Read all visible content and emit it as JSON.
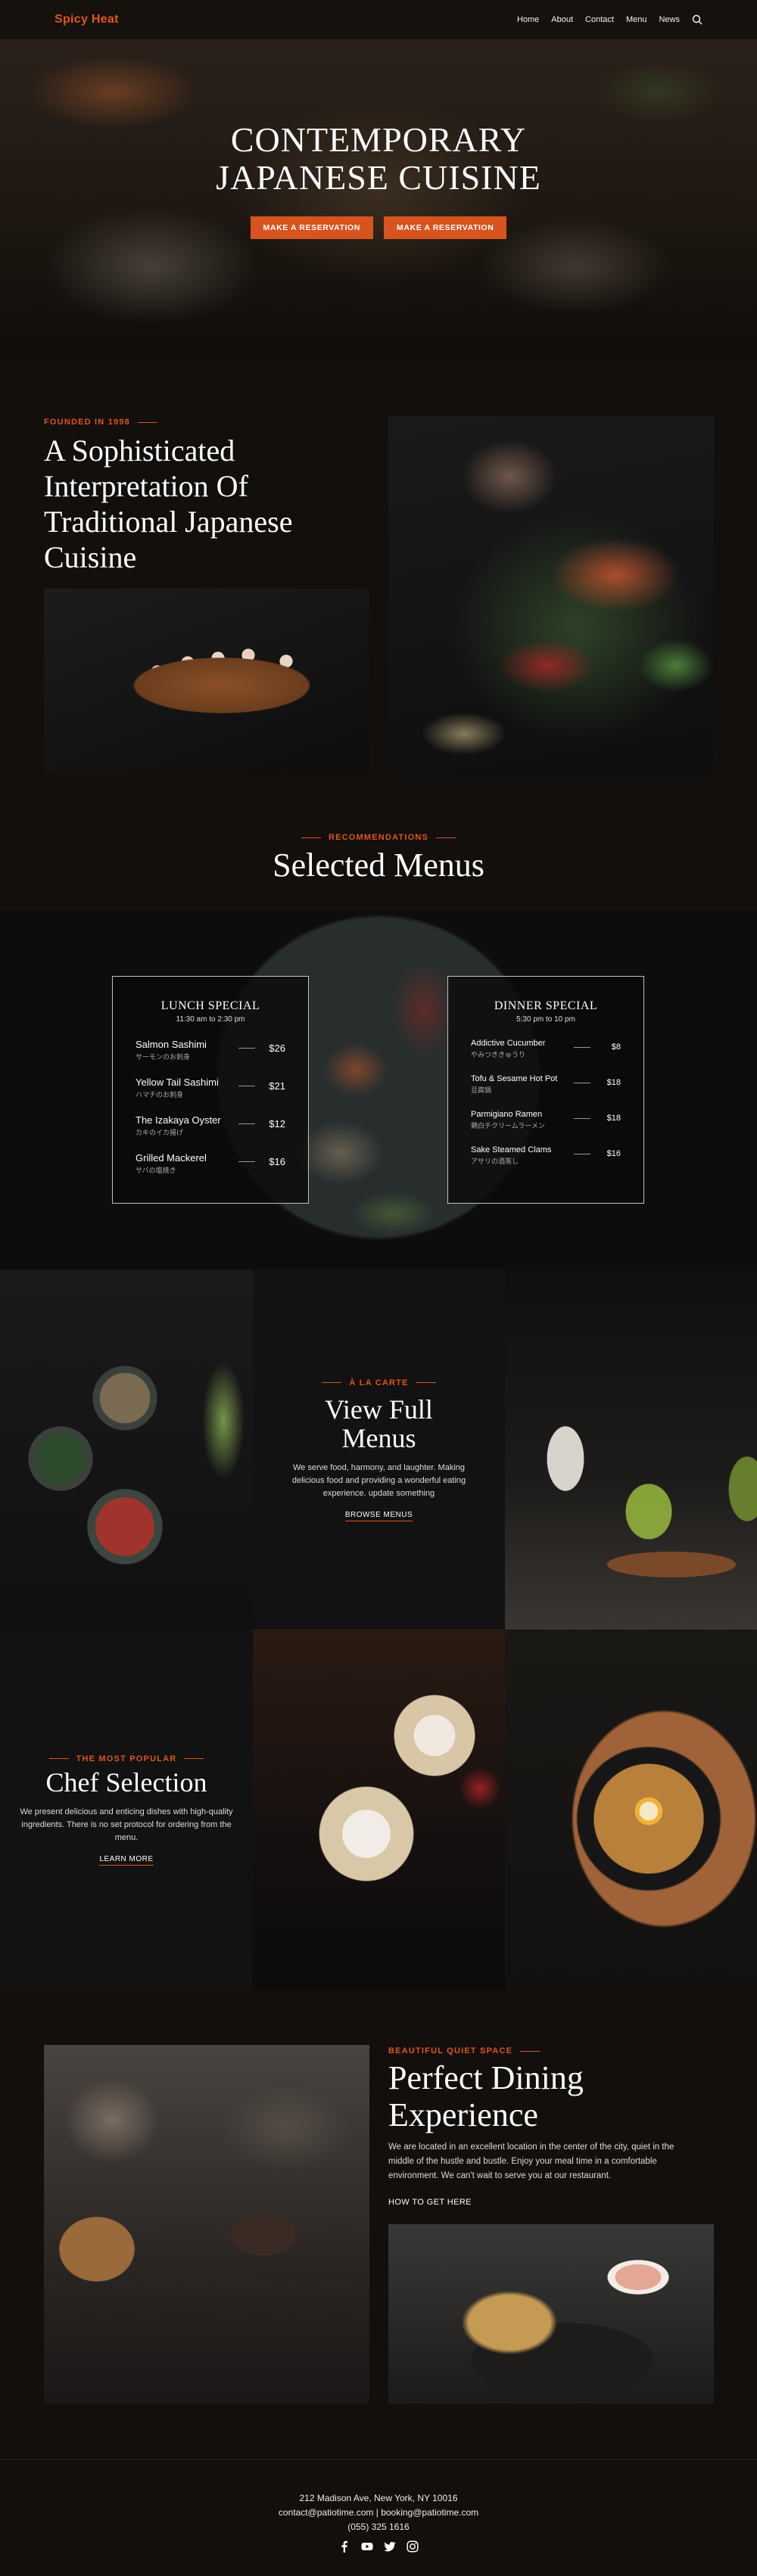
{
  "header": {
    "logo": "Spicy Heat",
    "nav": [
      "Home",
      "About",
      "Contact",
      "Menu",
      "News"
    ]
  },
  "hero": {
    "title_line1": "CONTEMPORARY",
    "title_line2": "JAPANESE CUISINE",
    "button1": "MAKE A RESERVATION",
    "button2": "MAKE A RESERVATION"
  },
  "about": {
    "eyebrow": "FOUNDED IN 1998",
    "title": "A Sophisticated Interpretation Of Traditional Japanese Cuisine"
  },
  "recommendations": {
    "eyebrow": "RECOMMENDATIONS",
    "title": "Selected Menus"
  },
  "lunch": {
    "title": "LUNCH SPECIAL",
    "hours": "11:30 am to 2:30 pm",
    "items": [
      {
        "name": "Salmon Sashimi",
        "sub": "サーモンのお刺身",
        "price": "$26"
      },
      {
        "name": "Yellow Tail Sashimi",
        "sub": "ハマチのお刺身",
        "price": "$21"
      },
      {
        "name": "The Izakaya Oyster",
        "sub": "カキのイカ揚げ",
        "price": "$12"
      },
      {
        "name": "Grilled Mackerel",
        "sub": "サバの塩焼き",
        "price": "$16"
      }
    ]
  },
  "dinner": {
    "title": "DINNER SPECIAL",
    "hours": "5:30 pm to 10 pm",
    "items": [
      {
        "name": "Addictive Cucumber",
        "sub": "やみつききゅうり",
        "price": "$8"
      },
      {
        "name": "Tofu & Sesame Hot Pot",
        "sub": "豆腐鍋",
        "price": "$18"
      },
      {
        "name": "Parmigiano Ramen",
        "sub": "鶏白チクリームラーメン",
        "price": "$18"
      },
      {
        "name": "Sake Steamed Clams",
        "sub": "アサリの酒蒸し",
        "price": "$16"
      }
    ]
  },
  "alacarte": {
    "eyebrow": "À LA CARTE",
    "title": "View Full Menus",
    "desc": "We serve food, harmony, and laughter. Making delicious food and providing a wonderful eating experience. update something",
    "link": "BROWSE MENUS"
  },
  "chef": {
    "eyebrow": "THE MOST POPULAR",
    "title": "Chef Selection",
    "desc": "We present delicious and enticing dishes with high-quality ingredients. There is no set protocol for ordering from the menu.",
    "link": "LEARN MORE"
  },
  "dining": {
    "eyebrow": "BEAUTIFUL QUIET SPACE",
    "title": "Perfect Dining Experience",
    "desc": "We are located in an excellent location in the center of the city, quiet in the middle of the hustle and bustle. Enjoy your meal time in a comfortable environment. We can't wait to serve you at our restaurant.",
    "link": "HOW TO GET HERE"
  },
  "footer": {
    "address": "212 Madison Ave, New York, NY 10016",
    "emails": "contact@patiotime.com  |  booking@patiotime.com",
    "phone": "(055) 325 1616"
  },
  "icons": [
    "search-icon",
    "facebook-icon",
    "youtube-icon",
    "twitter-icon",
    "instagram-icon"
  ],
  "colors": {
    "accent": "#e1531b",
    "background": "#120f0c"
  }
}
